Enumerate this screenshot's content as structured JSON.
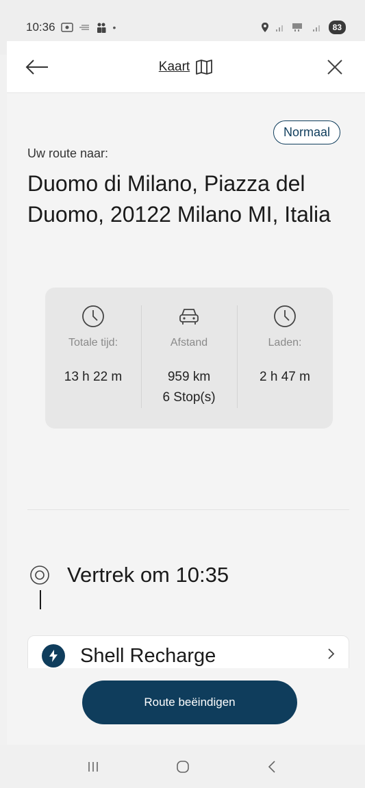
{
  "status_bar": {
    "time": "10:36",
    "battery": "83"
  },
  "header": {
    "map_label": "Kaart"
  },
  "route": {
    "mode_badge": "Normaal",
    "label": "Uw route naar:",
    "destination": "Duomo di Milano, Piazza del Duomo, 20122 Milano MI, Italia"
  },
  "summary": {
    "total_time_label": "Totale tijd:",
    "total_time_value": "13 h 22 m",
    "distance_label": "Afstand",
    "distance_value": "959 km",
    "stops_value": "6 Stop(s)",
    "charging_label": "Laden:",
    "charging_value": "2 h 47 m"
  },
  "itinerary": {
    "departure": "Vertrek om 10:35",
    "first_stop": "Shell Recharge"
  },
  "actions": {
    "end_route": "Route beëindigen"
  },
  "colors": {
    "accent": "#0f3d5c",
    "background": "#f4f4f4",
    "card": "#e7e7e7"
  }
}
